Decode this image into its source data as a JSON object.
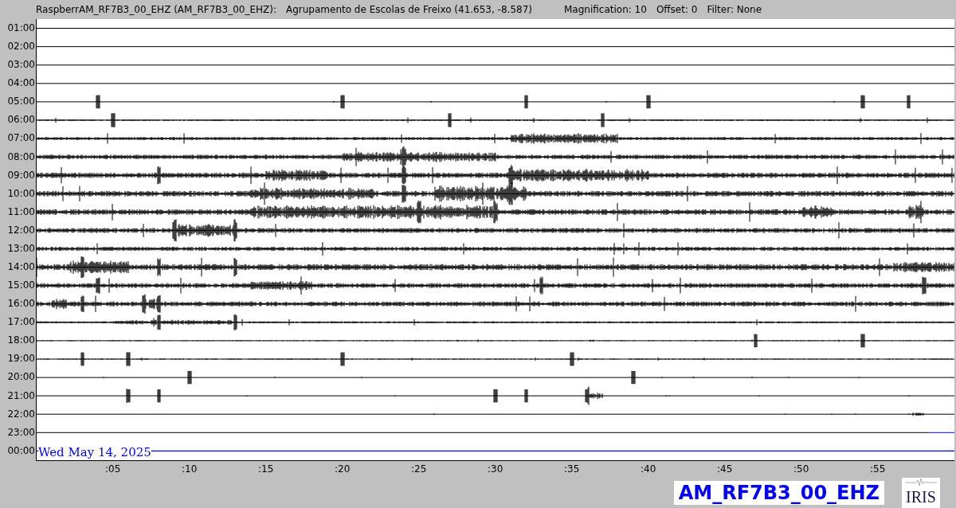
{
  "header": {
    "station": "RaspberrAM_RF7B3_00_EHZ (AM_RF7B3_00_EHZ):",
    "location": "Agrupamento de Escolas de Freixo (41.653, -8.587)",
    "magnification": "Magnification: 10",
    "offset": "Offset: 0",
    "filter": "Filter: None"
  },
  "rows": [
    {
      "label": "01:00",
      "kind": "trace"
    },
    {
      "label": "02:00",
      "kind": "trace"
    },
    {
      "label": "03:00",
      "kind": "trace"
    },
    {
      "label": "04:00",
      "kind": "trace"
    },
    {
      "label": "05:00",
      "kind": "trace"
    },
    {
      "label": "06:00",
      "kind": "trace"
    },
    {
      "label": "07:00",
      "kind": "trace"
    },
    {
      "label": "08:00",
      "kind": "trace"
    },
    {
      "label": "09:00",
      "kind": "trace"
    },
    {
      "label": "10:00",
      "kind": "trace"
    },
    {
      "label": "11:00",
      "kind": "trace"
    },
    {
      "label": "12:00",
      "kind": "trace"
    },
    {
      "label": "13:00",
      "kind": "trace"
    },
    {
      "label": "14:00",
      "kind": "trace"
    },
    {
      "label": "15:00",
      "kind": "trace"
    },
    {
      "label": "16:00",
      "kind": "trace"
    },
    {
      "label": "17:00",
      "kind": "trace"
    },
    {
      "label": "18:00",
      "kind": "trace"
    },
    {
      "label": "19:00",
      "kind": "trace"
    },
    {
      "label": "20:00",
      "kind": "trace"
    },
    {
      "label": "21:00",
      "kind": "trace"
    },
    {
      "label": "22:00",
      "kind": "trace"
    },
    {
      "label": "23:00",
      "kind": "trace"
    },
    {
      "label": "00:00",
      "kind": "current"
    }
  ],
  "date": "Wed May 14, 2025",
  "x_ticks": [
    ":05",
    ":10",
    ":15",
    ":20",
    ":25",
    ":30",
    ":35",
    ":40",
    ":45",
    ":50",
    ":55"
  ],
  "station_label": "AM_RF7B3_00_EHZ",
  "logo_text": "IRIS"
}
